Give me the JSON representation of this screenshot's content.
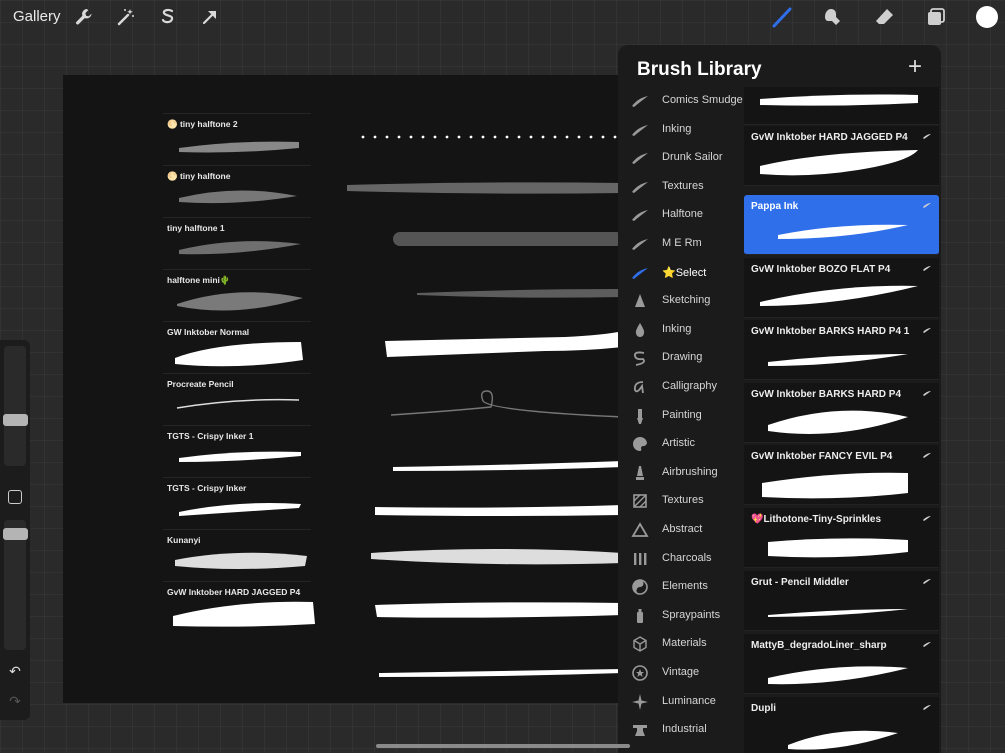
{
  "topbar": {
    "gallery_label": "Gallery",
    "left_icons": [
      "wrench-icon",
      "magic-wand-icon",
      "selection-s-icon",
      "transform-arrow-icon"
    ],
    "right_icons": [
      "brush-icon",
      "smudge-icon",
      "eraser-icon",
      "layers-icon",
      "color-swatch-icon"
    ],
    "accent_color": "#2f6fea",
    "current_color": "#ffffff"
  },
  "canvas": {
    "stroke_labels": [
      "🌕 tiny halftone 2",
      "🌕 tiny halftone",
      "tiny halftone 1",
      "halftone mini🌵",
      "GW Inktober Normal",
      "Procreate Pencil",
      "TGTS - Crispy Inker 1",
      "TGTS - Crispy Inker",
      "Kunanyi",
      "GvW Inktober HARD JAGGED P4"
    ]
  },
  "leftbar": {
    "size_level": 0.3,
    "opacity_level": 0.3,
    "undo_icon": "undo-icon",
    "redo_icon": "redo-icon"
  },
  "library": {
    "title": "Brush Library",
    "add_icon": "plus-icon",
    "sets": [
      {
        "label": "Comics Smudge",
        "icon": "stroke"
      },
      {
        "label": "Inking",
        "icon": "stroke"
      },
      {
        "label": "Drunk Sailor",
        "icon": "stroke"
      },
      {
        "label": "Textures",
        "icon": "stroke"
      },
      {
        "label": "Halftone",
        "icon": "stroke"
      },
      {
        "label": "M E Rm",
        "icon": "stroke"
      },
      {
        "label": "⭐Select",
        "icon": "stroke-active"
      },
      {
        "label": "Sketching",
        "icon": "pencil-tip"
      },
      {
        "label": "Inking",
        "icon": "ink-drop"
      },
      {
        "label": "Drawing",
        "icon": "squiggle"
      },
      {
        "label": "Calligraphy",
        "icon": "calligraphy-a"
      },
      {
        "label": "Painting",
        "icon": "paintbrush"
      },
      {
        "label": "Artistic",
        "icon": "palette"
      },
      {
        "label": "Airbrushing",
        "icon": "airbrush"
      },
      {
        "label": "Textures",
        "icon": "hatch"
      },
      {
        "label": "Abstract",
        "icon": "triangle"
      },
      {
        "label": "Charcoals",
        "icon": "charcoal-bars"
      },
      {
        "label": "Elements",
        "icon": "yin-yang"
      },
      {
        "label": "Spraypaints",
        "icon": "spray-can"
      },
      {
        "label": "Materials",
        "icon": "cube"
      },
      {
        "label": "Vintage",
        "icon": "star-circle"
      },
      {
        "label": "Luminance",
        "icon": "sparkle"
      },
      {
        "label": "Industrial",
        "icon": "anvil"
      }
    ],
    "active_set_index": 6,
    "brushes": [
      {
        "name": ""
      },
      {
        "name": "GvW Inktober HARD JAGGED P4"
      },
      {
        "name": "Pappa Ink"
      },
      {
        "name": "GvW Inktober BOZO FLAT P4"
      },
      {
        "name": "GvW Inktober BARKS HARD P4 1"
      },
      {
        "name": "GvW Inktober BARKS HARD P4"
      },
      {
        "name": "GvW Inktober FANCY EVIL P4"
      },
      {
        "name": "💖Lithotone-Tiny-Sprinkles"
      },
      {
        "name": "Grut - Pencil Middler"
      },
      {
        "name": "MattyB_degradoLiner_sharp"
      },
      {
        "name": "Dupli"
      }
    ],
    "selected_brush_index": 2
  }
}
